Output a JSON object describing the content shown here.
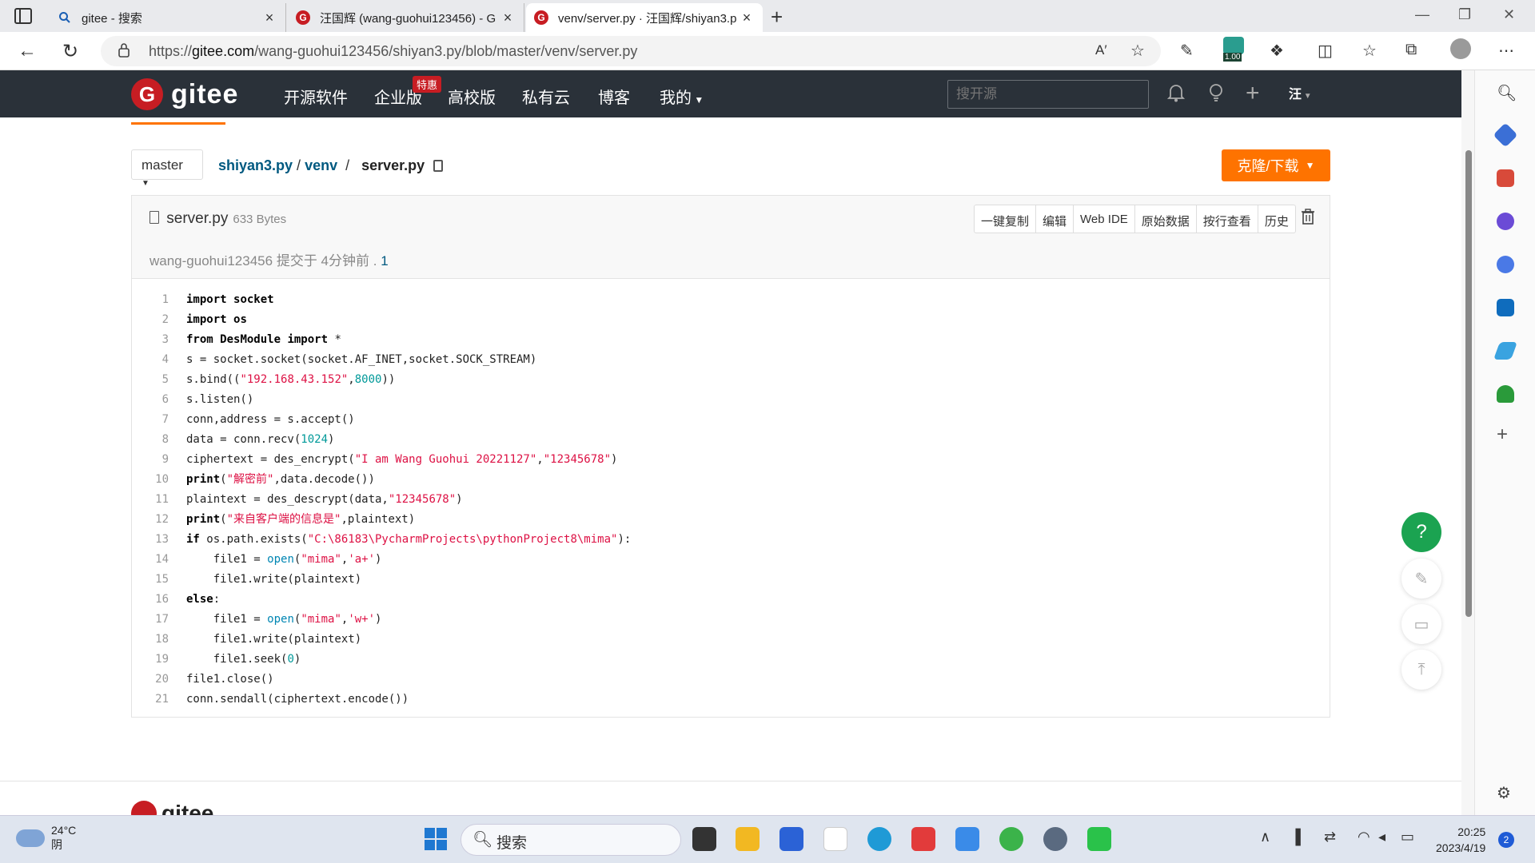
{
  "browser": {
    "tabs": [
      {
        "title": "gitee - 搜索",
        "icon": "search-icon"
      },
      {
        "title": "汪国辉 (wang-guohui123456) - G",
        "icon": "gitee-icon"
      },
      {
        "title": "venv/server.py · 汪国辉/shiyan3.p",
        "icon": "gitee-icon"
      }
    ],
    "url_prefix": "https://",
    "url_host": "gitee.com",
    "url_path": "/wang-guohui123456/shiyan3.py/blob/master/venv/server.py",
    "ext_badge": "1.00",
    "new_tab": "+",
    "close_glyph": "×"
  },
  "gitee": {
    "logo_text": "gitee",
    "logo_glyph": "G",
    "nav": [
      "开源软件",
      "企业版",
      "高校版",
      "私有云",
      "博客",
      "我的"
    ],
    "hot_badge": "特惠",
    "search_placeholder": "搜开源",
    "avatar_text": "汪",
    "accent": "#fe7300",
    "brand": "#c71d23"
  },
  "repo": {
    "branch": "master",
    "crumbs": [
      "shiyan3.py",
      "venv",
      "server.py"
    ],
    "clone_label": "克隆/下载",
    "file_name": "server.py",
    "file_size": "633 Bytes",
    "commit_author": "wang-guohui123456",
    "commit_text": "提交于 4分钟前 .",
    "commit_hash": "1",
    "actions": [
      "一键复制",
      "编辑",
      "Web IDE",
      "原始数据",
      "按行查看",
      "历史"
    ]
  },
  "code_lines": [
    [
      [
        "kw",
        "import"
      ],
      [
        "t",
        " "
      ],
      [
        "kw",
        "socket"
      ]
    ],
    [
      [
        "kw",
        "import"
      ],
      [
        "t",
        " "
      ],
      [
        "kw",
        "os"
      ]
    ],
    [
      [
        "kw",
        "from"
      ],
      [
        "t",
        " "
      ],
      [
        "kw",
        "DesModule"
      ],
      [
        "t",
        " "
      ],
      [
        "kw",
        "import"
      ],
      [
        "t",
        " *"
      ]
    ],
    [
      [
        "t",
        "s = socket.socket(socket.AF_INET,socket.SOCK_STREAM)"
      ]
    ],
    [
      [
        "t",
        "s.bind(("
      ],
      [
        "str",
        "\"192.168.43.152\""
      ],
      [
        "t",
        ","
      ],
      [
        "num",
        "8000"
      ],
      [
        "t",
        "))"
      ]
    ],
    [
      [
        "t",
        "s.listen()"
      ]
    ],
    [
      [
        "t",
        "conn,address = s.accept()"
      ]
    ],
    [
      [
        "t",
        "data = conn.recv("
      ],
      [
        "num",
        "1024"
      ],
      [
        "t",
        ")"
      ]
    ],
    [
      [
        "t",
        "ciphertext = des_encrypt("
      ],
      [
        "str",
        "\"I am Wang Guohui 20221127\""
      ],
      [
        "t",
        ","
      ],
      [
        "str",
        "\"12345678\""
      ],
      [
        "t",
        ")"
      ]
    ],
    [
      [
        "kw",
        "print"
      ],
      [
        "t",
        "("
      ],
      [
        "str",
        "\"解密前\""
      ],
      [
        "t",
        ",data.decode())"
      ]
    ],
    [
      [
        "t",
        "plaintext = des_descrypt(data,"
      ],
      [
        "str",
        "\"12345678\""
      ],
      [
        "t",
        ")"
      ]
    ],
    [
      [
        "kw",
        "print"
      ],
      [
        "t",
        "("
      ],
      [
        "str",
        "\"来自客户端的信息是\""
      ],
      [
        "t",
        ",plaintext)"
      ]
    ],
    [
      [
        "kw",
        "if"
      ],
      [
        "t",
        " os.path.exists("
      ],
      [
        "str",
        "\"C:\\86183\\PycharmProjects\\pythonProject8\\mima\""
      ],
      [
        "t",
        "):"
      ]
    ],
    [
      [
        "t",
        "    file1 = "
      ],
      [
        "fn",
        "open"
      ],
      [
        "t",
        "("
      ],
      [
        "str",
        "\"mima\""
      ],
      [
        "t",
        ","
      ],
      [
        "str",
        "'a+'"
      ],
      [
        "t",
        ")"
      ]
    ],
    [
      [
        "t",
        "    file1.write(plaintext)"
      ]
    ],
    [
      [
        "kw",
        "else"
      ],
      [
        "t",
        ":"
      ]
    ],
    [
      [
        "t",
        "    file1 = "
      ],
      [
        "fn",
        "open"
      ],
      [
        "t",
        "("
      ],
      [
        "str",
        "\"mima\""
      ],
      [
        "t",
        ","
      ],
      [
        "str",
        "'w+'"
      ],
      [
        "t",
        ")"
      ]
    ],
    [
      [
        "t",
        "    file1.write(plaintext)"
      ]
    ],
    [
      [
        "t",
        "    file1.seek("
      ],
      [
        "num",
        "0"
      ],
      [
        "t",
        ")"
      ]
    ],
    [
      [
        "t",
        "file1.close()"
      ]
    ],
    [
      [
        "t",
        "conn.sendall(ciphertext.encode())"
      ]
    ]
  ],
  "floating": {
    "help": "?"
  },
  "taskbar": {
    "temp": "24°C",
    "weather": "阴",
    "search": "搜索",
    "time": "20:25",
    "date": "2023/4/19",
    "notif_count": "2"
  }
}
